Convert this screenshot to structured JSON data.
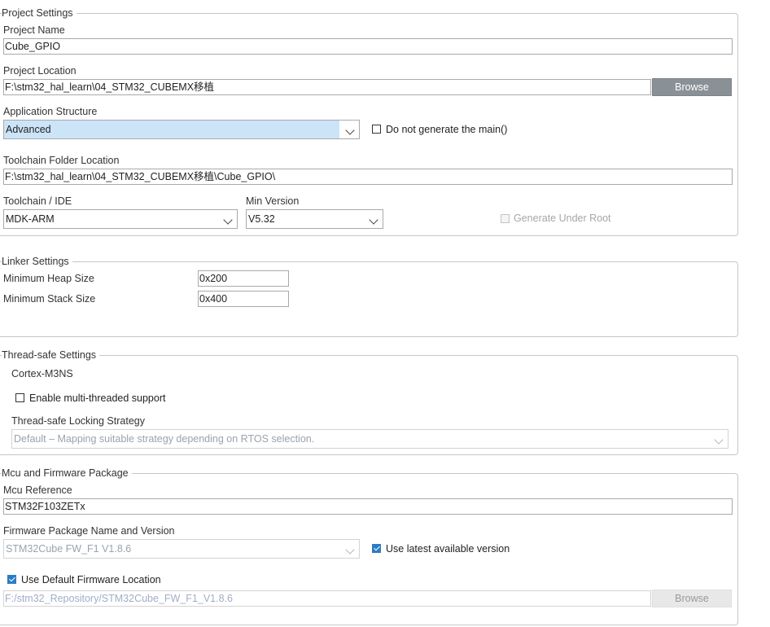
{
  "project_settings": {
    "title": "Project Settings",
    "project_name_label": "Project Name",
    "project_name_value": "Cube_GPIO",
    "project_location_label": "Project Location",
    "project_location_value": "F:\\stm32_hal_learn\\04_STM32_CUBEMX移植",
    "browse_label": "Browse",
    "app_structure_label": "Application Structure",
    "app_structure_value": "Advanced",
    "no_main_label": "Do not generate the main()",
    "no_main_checked": false,
    "toolchain_folder_label": "Toolchain Folder Location",
    "toolchain_folder_value": "F:\\stm32_hal_learn\\04_STM32_CUBEMX移植\\Cube_GPIO\\",
    "toolchain_ide_label": "Toolchain / IDE",
    "toolchain_ide_value": "MDK-ARM",
    "min_version_label": "Min Version",
    "min_version_value": "V5.32",
    "generate_under_root_label": "Generate Under Root",
    "generate_under_root_checked": false
  },
  "linker_settings": {
    "title": "Linker Settings",
    "heap_label": "Minimum Heap Size",
    "heap_value": "0x200",
    "stack_label": "Minimum Stack Size",
    "stack_value": "0x400"
  },
  "thread_safe_settings": {
    "title": "Thread-safe Settings",
    "core_label": "Cortex-M3NS",
    "multithread_label": "Enable multi-threaded support",
    "multithread_checked": false,
    "locking_strategy_label": "Thread-safe Locking Strategy",
    "locking_strategy_value": "Default  –  Mapping suitable strategy depending on RTOS selection."
  },
  "mcu_firmware": {
    "title": "Mcu and Firmware Package",
    "mcu_reference_label": "Mcu Reference",
    "mcu_reference_value": "STM32F103ZETx",
    "fw_package_label": "Firmware Package Name and Version",
    "fw_package_value": "STM32Cube FW_F1 V1.8.6",
    "use_latest_label": "Use latest available version",
    "use_latest_checked": true,
    "use_default_location_label": "Use Default Firmware Location",
    "use_default_location_checked": true,
    "fw_location_value": "F:/stm32_Repository/STM32Cube_FW_F1_V1.8.6",
    "browse_label": "Browse"
  },
  "colors": {
    "accent": "#2c7cc4",
    "selection": "#cce4f7",
    "button": "#8a9196"
  }
}
